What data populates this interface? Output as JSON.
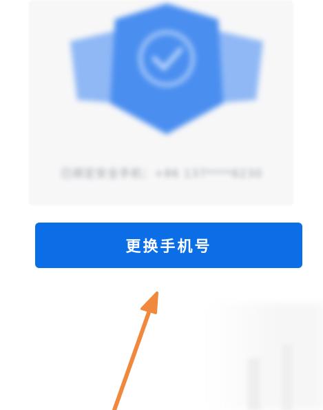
{
  "security_card": {
    "shield_icon": "shield-check-icon",
    "phone_text": "已绑定安全手机：+86 137****6230"
  },
  "primary_action": {
    "label": "更换手机号"
  },
  "annotation": {
    "arrow_icon": "arrow-up-icon",
    "arrow_color": "#f0883e"
  },
  "colors": {
    "button_bg": "#0b6ee6",
    "shield_main": "#4a8ef0",
    "shield_side": "#8ab6f6"
  }
}
